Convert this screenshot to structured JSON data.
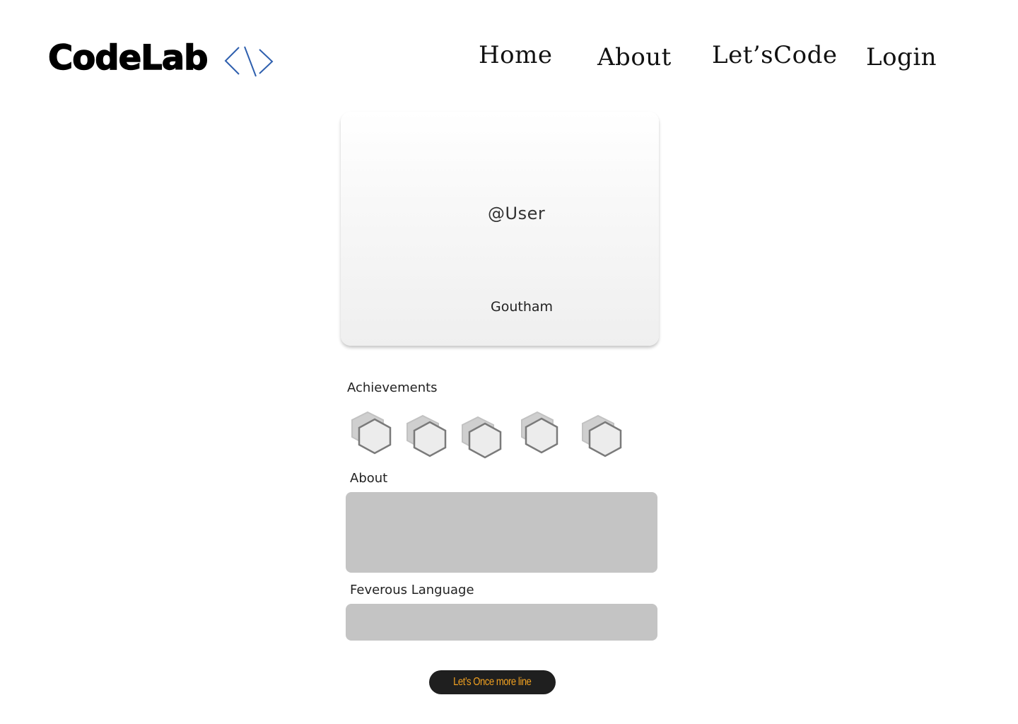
{
  "header": {
    "logo_text": "CodeLab",
    "logo_icon": "code-brackets-icon",
    "logo_icon_color": "#2e5fae",
    "nav": {
      "home": "Home",
      "about": "About",
      "letscode": "Let’sCode",
      "login": "Login"
    }
  },
  "profile": {
    "username": "@User",
    "name": "Goutham"
  },
  "achievements": {
    "label": "Achievements",
    "badges": [
      "hexagon-badge-icon",
      "hexagon-badge-icon",
      "hexagon-badge-icon",
      "hexagon-badge-icon",
      "hexagon-badge-icon"
    ]
  },
  "about": {
    "label": "About",
    "value": ""
  },
  "language": {
    "label": "Feverous Language",
    "value": ""
  },
  "cta": {
    "label": "Let’s Once more line",
    "text_color": "#f0a020",
    "background": "#1f1f1f"
  },
  "colors": {
    "field_background": "#c4c4c4",
    "badge_stroke": "#7a7a7a",
    "badge_shadow": "#c9c9c9"
  }
}
